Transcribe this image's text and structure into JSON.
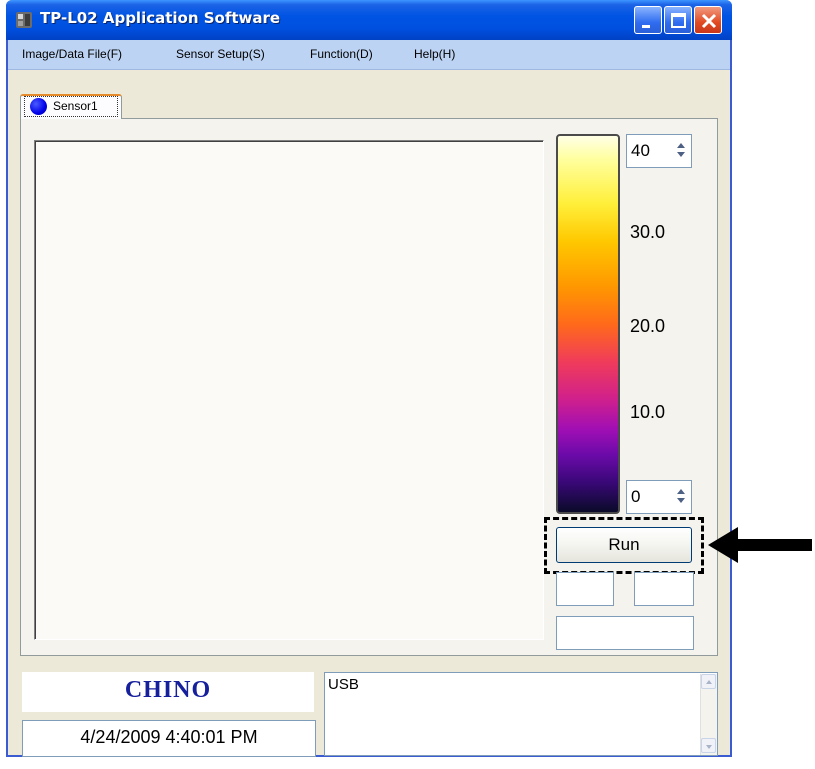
{
  "window": {
    "title": "TP-L02 Application Software",
    "title_bar_color": "#0054e3"
  },
  "menu": {
    "items": [
      {
        "label": "Image/Data File(F)"
      },
      {
        "label": "Sensor Setup(S)"
      },
      {
        "label": "Function(D)"
      },
      {
        "label": "Help(H)"
      }
    ]
  },
  "tabs": [
    {
      "label": "Sensor1",
      "indicator_color": "#0000e8",
      "selected": true
    }
  ],
  "color_scale": {
    "max_value": "40",
    "min_value": "0",
    "labels": [
      "30.0",
      "20.0",
      "10.0"
    ],
    "palette": "ironbow"
  },
  "run_button": {
    "label": "Run"
  },
  "logo": {
    "text": "CHINO",
    "color": "#17209c"
  },
  "datetime": "4/24/2009 4:40:01 PM",
  "status": {
    "text": "USB"
  }
}
